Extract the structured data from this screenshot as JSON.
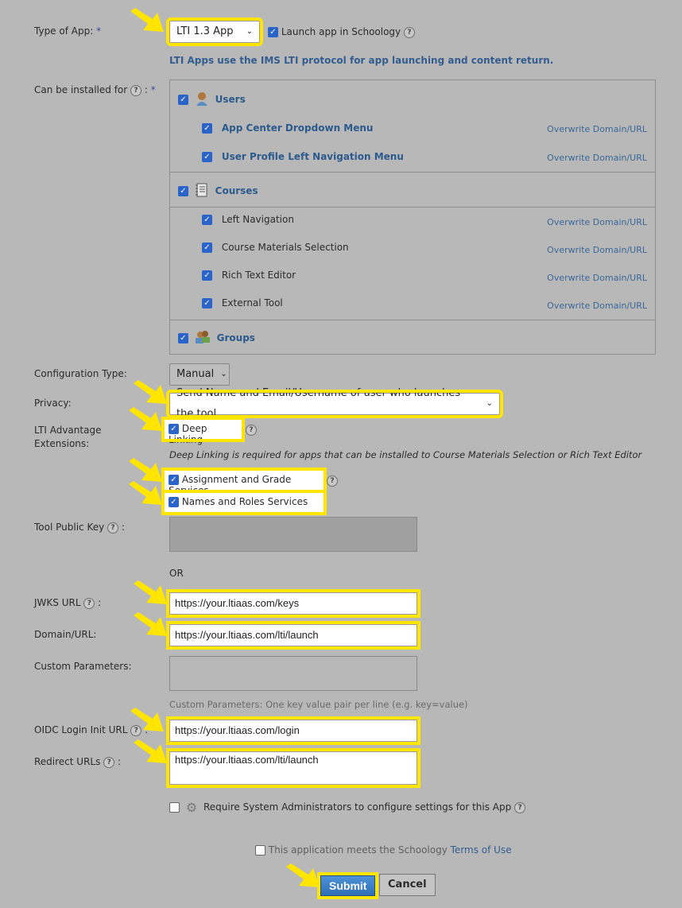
{
  "type_of_app": {
    "label": "Type of App:",
    "required_mark": "*",
    "select_value": "LTI 1.3 App",
    "launch_in_schoology_label": "Launch app in Schoology",
    "launch_in_schoology_checked": true,
    "hint": "LTI Apps use the IMS LTI protocol for app launching and content return."
  },
  "installed_for": {
    "label": "Can be installed for",
    "required_mark": "*",
    "groups": [
      {
        "name": "Users",
        "icon": "user-icon",
        "checked": true,
        "items": [
          {
            "label": "App Center Dropdown Menu",
            "checked": true,
            "link": "Overwrite Domain/URL"
          },
          {
            "label": "User Profile Left Navigation Menu",
            "checked": true,
            "link": "Overwrite Domain/URL"
          }
        ]
      },
      {
        "name": "Courses",
        "icon": "notebook-icon",
        "checked": true,
        "items": [
          {
            "label": "Left Navigation",
            "checked": true,
            "link": "Overwrite Domain/URL"
          },
          {
            "label": "Course Materials Selection",
            "checked": true,
            "link": "Overwrite Domain/URL"
          },
          {
            "label": "Rich Text Editor",
            "checked": true,
            "link": "Overwrite Domain/URL"
          },
          {
            "label": "External Tool",
            "checked": true,
            "link": "Overwrite Domain/URL"
          }
        ]
      },
      {
        "name": "Groups",
        "icon": "group-icon",
        "checked": true,
        "items": []
      }
    ]
  },
  "configuration_type": {
    "label": "Configuration Type:",
    "value": "Manual"
  },
  "privacy": {
    "label": "Privacy:",
    "value": "Send Name and Email/Username of user who launches the tool"
  },
  "lti_advantage": {
    "label_line1": "LTI Advantage",
    "label_line2": "Extensions:",
    "deep_linking": {
      "label": "Deep Linking",
      "checked": true
    },
    "deep_linking_note": "Deep Linking is required for apps that can be installed to Course Materials Selection or Rich Text Editor",
    "ags": {
      "label": "Assignment and Grade Services",
      "checked": true
    },
    "nrps": {
      "label": "Names and Roles Services",
      "checked": true
    }
  },
  "tool_public_key": {
    "label": "Tool Public Key",
    "value": ""
  },
  "or_text": "OR",
  "jwks_url": {
    "label": "JWKS URL",
    "value": "https://your.ltiaas.com/keys"
  },
  "domain_url": {
    "label": "Domain/URL:",
    "value": "https://your.ltiaas.com/lti/launch"
  },
  "custom_parameters": {
    "label": "Custom Parameters:",
    "value": "",
    "hint": "Custom Parameters: One key value pair per line (e.g. key=value)"
  },
  "oidc_login": {
    "label": "OIDC Login Init URL",
    "value": "https://your.ltiaas.com/login"
  },
  "redirect_urls": {
    "label": "Redirect URLs",
    "value": "https://your.ltiaas.com/lti/launch"
  },
  "require_admin": {
    "label": "Require System Administrators to configure settings for this App",
    "checked": false
  },
  "terms": {
    "prefix": "This application meets the Schoology",
    "link": "Terms of Use",
    "checked": false
  },
  "buttons": {
    "submit": "Submit",
    "cancel": "Cancel"
  },
  "colors": {
    "highlight": "#ffe500",
    "link": "#335d8f",
    "background": "#b8b8b8",
    "checkbox": "#2a63c9"
  }
}
